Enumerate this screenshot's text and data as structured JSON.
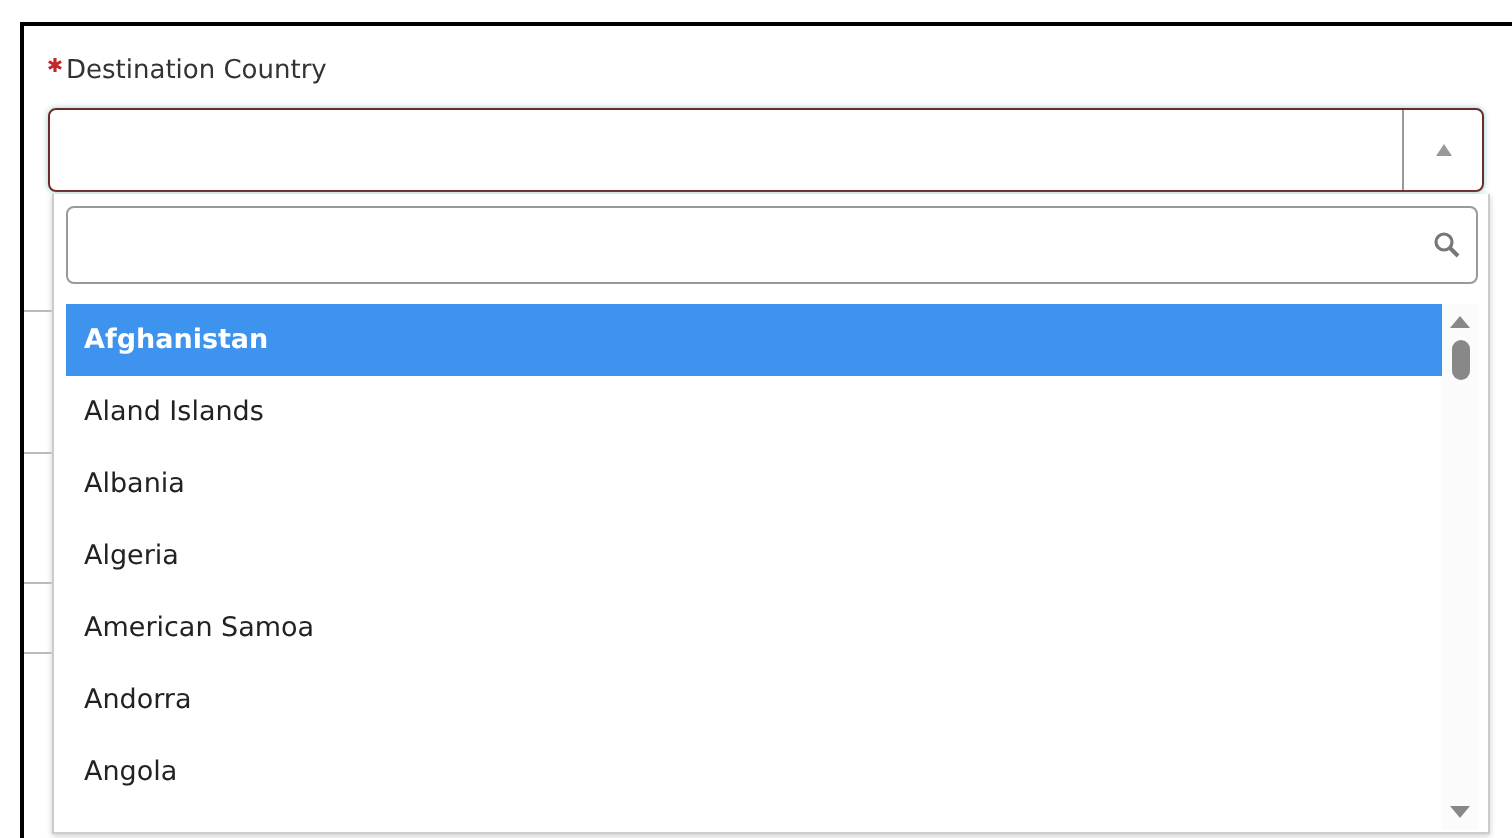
{
  "field": {
    "label": "Destination Country",
    "required": true,
    "expanded": true
  },
  "options": [
    {
      "label": "Afghanistan",
      "selected": true
    },
    {
      "label": "Aland Islands",
      "selected": false
    },
    {
      "label": "Albania",
      "selected": false
    },
    {
      "label": "Algeria",
      "selected": false
    },
    {
      "label": "American Samoa",
      "selected": false
    },
    {
      "label": "Andorra",
      "selected": false
    },
    {
      "label": "Angola",
      "selected": false
    }
  ]
}
